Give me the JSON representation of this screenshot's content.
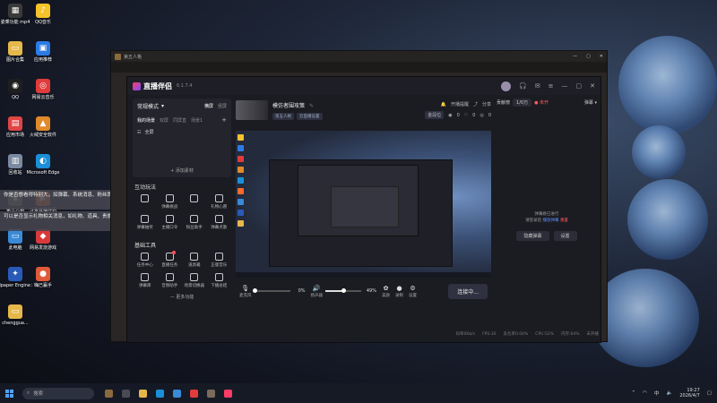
{
  "desktop": {
    "icons": [
      {
        "label": "姿乘功能 mp4",
        "glyph": "▦",
        "color": "#3a3a3a"
      },
      {
        "label": "QQ音乐",
        "glyph": "♪",
        "color": "#f4c32a"
      },
      {
        "label": "图片合集",
        "glyph": "▭",
        "color": "#e6b84a"
      },
      {
        "label": "应用推荐",
        "glyph": "▣",
        "color": "#2c7be5"
      },
      {
        "label": "QQ",
        "glyph": "◉",
        "color": "#1e1e1e"
      },
      {
        "label": "网易云音乐",
        "glyph": "◎",
        "color": "#e03c3c"
      },
      {
        "label": "应用市场",
        "glyph": "▤",
        "color": "#e04545"
      },
      {
        "label": "火绒安全软件",
        "glyph": "▲",
        "color": "#e08a2a"
      },
      {
        "label": "回收站",
        "glyph": "▥",
        "color": "#7a8aa0"
      },
      {
        "label": "Microsoft Edge",
        "glyph": "◐",
        "color": "#1a8fd8"
      },
      {
        "label": "第五人格",
        "glyph": "♞",
        "color": "#7a6a5a"
      },
      {
        "label": "斗鱼直播伴侣",
        "glyph": "▶",
        "color": "#ff6a2a"
      },
      {
        "label": "此电脑",
        "glyph": "▭",
        "color": "#3a8ad8"
      },
      {
        "label": "网易发烧游戏",
        "glyph": "◆",
        "color": "#d83a3a"
      },
      {
        "label": "Wallpaper Engine：...",
        "glyph": "✦",
        "color": "#2a5ab8"
      },
      {
        "label": "嗨已赢手",
        "glyph": "●",
        "color": "#e05a3a"
      },
      {
        "label": "chenggua...",
        "glyph": "▭",
        "color": "#e6b84a"
      }
    ],
    "tooltip1": "你是否想看得特别大，如弹幕、系统消息、粉丝牌升级等",
    "tooltip2": "可以是否显示礼物相关消息，如礼物、道具、贵族开通/续费、钻粉开通/续费等"
  },
  "host_window": {
    "title": "第五人格",
    "controls": [
      "—",
      "▢",
      "✕"
    ]
  },
  "app": {
    "brand": "直播伴侣",
    "version": "6.1.7.4",
    "header_icons": [
      "🎧",
      "✉",
      "≡",
      "—",
      "▢",
      "✕"
    ],
    "sidebar": {
      "mode": "常规模式",
      "mode_opts": [
        "横屏",
        "竖屏"
      ],
      "scene_tabs": [
        "我的场景",
        "双屏",
        "同屏直",
        "场景1"
      ],
      "scene_item": "全屏",
      "add_source": "+ 添加素材",
      "interact_title": "互动玩法",
      "interact_tools": [
        {
          "label": "",
          "dot": false
        },
        {
          "label": "弹幕挑战",
          "dot": false
        },
        {
          "label": "",
          "dot": false
        },
        {
          "label": "礼物心愿",
          "dot": false
        },
        {
          "label": "弹幕抽奖",
          "dot": false
        },
        {
          "label": "主播口令",
          "dot": false
        },
        {
          "label": "粉丝助手",
          "dot": false
        },
        {
          "label": "弹幕点歌",
          "dot": false
        }
      ],
      "basic_title": "基础工具",
      "basic_tools": [
        {
          "label": "任务中心",
          "dot": false
        },
        {
          "label": "直播任务",
          "dot": true
        },
        {
          "label": "道具箱",
          "dot": false
        },
        {
          "label": "正版音乐",
          "dot": false
        },
        {
          "label": "弹幕库",
          "dot": false
        },
        {
          "label": "音频助手",
          "dot": false
        },
        {
          "label": "场景切换器",
          "dot": false
        },
        {
          "label": "下播总结",
          "dot": false
        }
      ],
      "more": "— 更多功能"
    },
    "stream": {
      "title": "模仿者围攻策",
      "tags": [
        "第五人格",
        "云直播设置"
      ],
      "start_label": "开播提醒",
      "share_label": "分享",
      "extra_label": "金段位",
      "views": "0",
      "likes": "0",
      "views2": "0"
    },
    "controls": {
      "mic_label": "麦克风",
      "mic_pct": "0%",
      "mic_value": 0,
      "speaker_label": "扬声器",
      "speaker_pct": "49%",
      "speaker_value": 49,
      "btn1": "美颜",
      "btn2": "录制",
      "btn3": "设置",
      "live_btn": "连接中..."
    },
    "status": [
      "码率0Kb/s",
      "FPS:30",
      "丢包率0.00%",
      "CPU:52%",
      "内存:64%",
      "未开播"
    ],
    "right_panel": {
      "label": "贡献榜",
      "count": "1/0万",
      "status": "● 未开",
      "action": "弹幕 ▾",
      "msg1": "弹幕姬已进行",
      "msg2_a": "请登录后",
      "msg2_link": "播放弹幕",
      "msg2_red": "重置",
      "btn1": "隐藏弹幕",
      "btn2": "设置"
    }
  },
  "taskbar": {
    "search_placeholder": "搜索",
    "ime": "中",
    "time": "19:27",
    "date": "2026/4/7"
  }
}
